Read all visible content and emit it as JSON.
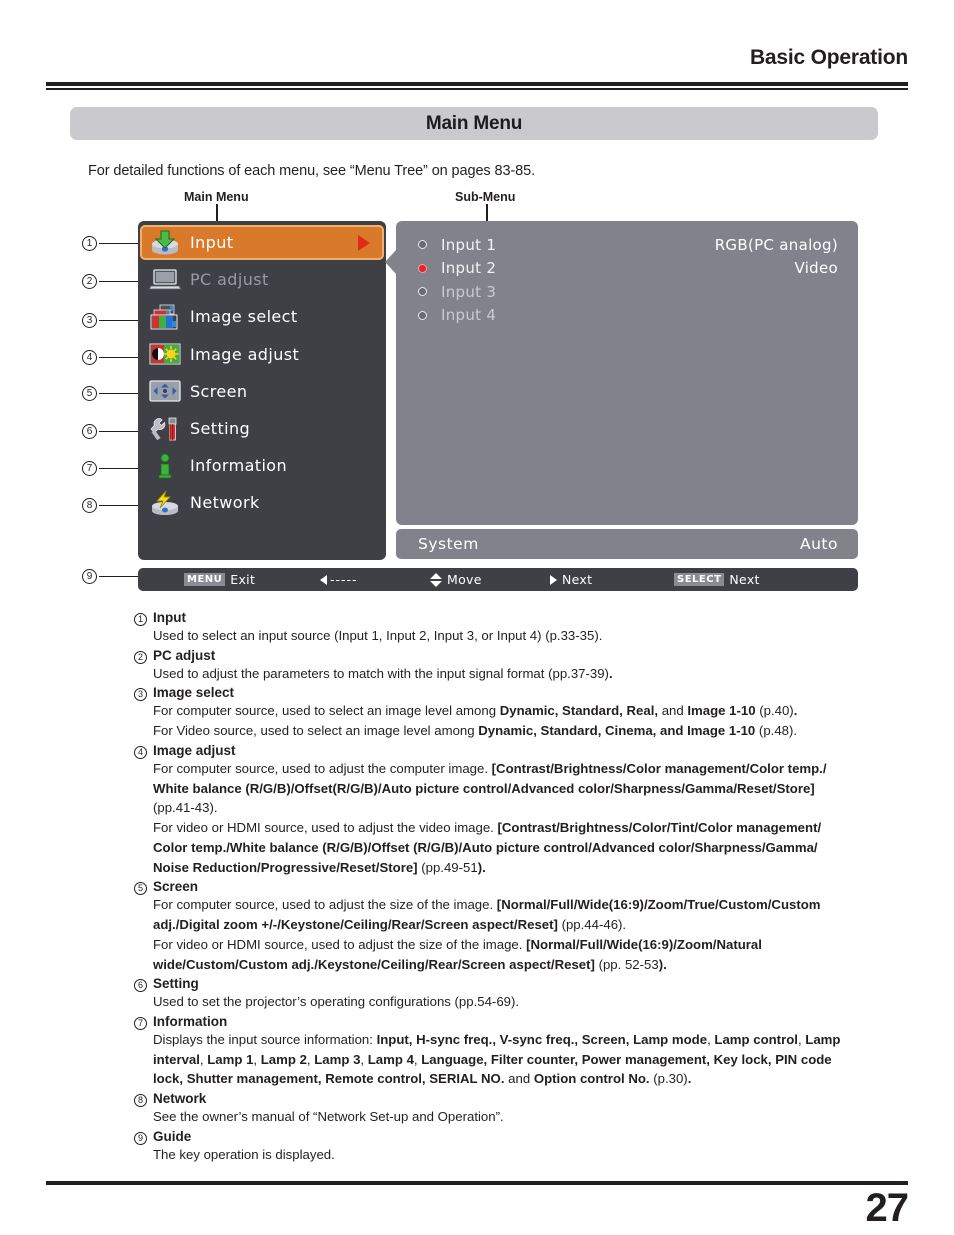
{
  "running_head": "Basic Operation",
  "section_title": "Main Menu",
  "intro": "For detailed functions of each menu, see “Menu Tree” on pages 83-85.",
  "figure": {
    "main_menu_label": "Main Menu",
    "sub_menu_label": "Sub-Menu",
    "main_items": [
      {
        "num": "1",
        "label": "Input",
        "icon": "input-device-download-icon",
        "state": "selected"
      },
      {
        "num": "2",
        "label": "PC adjust",
        "icon": "laptop-icon",
        "state": "disabled"
      },
      {
        "num": "3",
        "label": "Image select",
        "icon": "rgb-cards-icon",
        "state": "normal"
      },
      {
        "num": "4",
        "label": "Image adjust",
        "icon": "contrast-sun-icon",
        "state": "normal"
      },
      {
        "num": "5",
        "label": "Screen",
        "icon": "four-arrows-icon",
        "state": "normal"
      },
      {
        "num": "6",
        "label": "Setting",
        "icon": "wrench-screwdriver-icon",
        "state": "normal"
      },
      {
        "num": "7",
        "label": "Information",
        "icon": "info-i-icon",
        "state": "normal"
      },
      {
        "num": "8",
        "label": "Network",
        "icon": "network-bolt-icon",
        "state": "normal"
      }
    ],
    "sub_items": [
      {
        "label": "Input 1",
        "value": "RGB(PC analog)",
        "selected": false
      },
      {
        "label": "Input 2",
        "value": "Video",
        "selected": true
      },
      {
        "label": "Input 3",
        "value": "",
        "selected": false
      },
      {
        "label": "Input 4",
        "value": "",
        "selected": false
      }
    ],
    "system_row": {
      "label": "System",
      "value": "Auto"
    },
    "guide_bar": {
      "num": "9",
      "exit_key": "MENU",
      "exit_label": "Exit",
      "dashes": "-----",
      "move_label": "Move",
      "next_label": "Next",
      "select_key": "SELECT",
      "select_next_label": "Next"
    },
    "colors": {
      "highlight_orange": "#d97a2b",
      "panel_dark": "#3f3f46",
      "panel_gray": "#82828c",
      "selected_radio_red": "#e8202a",
      "arrow_red": "#e02b18"
    }
  },
  "descriptions": [
    {
      "num": "1",
      "title": "Input",
      "lines": [
        [
          {
            "t": "Used to select an input source (Input 1, Input 2, Input 3, or Input 4) (p.33-35).",
            "b": false
          }
        ]
      ]
    },
    {
      "num": "2",
      "title": "PC adjust",
      "lines": [
        [
          {
            "t": "Used to adjust the parameters to match with the input signal format (pp.37-39)",
            "b": false
          },
          {
            "t": ".",
            "b": true
          }
        ]
      ]
    },
    {
      "num": "3",
      "title": "Image select",
      "lines": [
        [
          {
            "t": "For computer source, used to select an image level among ",
            "b": false
          },
          {
            "t": "Dynamic, Standard, Real,",
            "b": true
          },
          {
            "t": " and ",
            "b": false
          },
          {
            "t": "Image 1-10",
            "b": true
          },
          {
            "t": " (p.40)",
            "b": false
          },
          {
            "t": ".",
            "b": true
          }
        ],
        [
          {
            "t": "For Video source, used to select an image level among ",
            "b": false
          },
          {
            "t": "Dynamic, Standard, Cinema, and Image 1-10",
            "b": true
          },
          {
            "t": " (p.48).",
            "b": false
          }
        ]
      ]
    },
    {
      "num": "4",
      "title": "Image adjust",
      "lines": [
        [
          {
            "t": "For computer source, used to adjust the computer image. ",
            "b": false
          },
          {
            "t": "[Contrast/Brightness/Color management/Color temp./",
            "b": true
          }
        ],
        [
          {
            "t": "White balance (R/G/B)/Offset(R/G/B)/Auto picture control/Advanced color/Sharpness/Gamma/Reset/Store]",
            "b": true
          }
        ],
        [
          {
            "t": "(pp.41-43).",
            "b": false
          }
        ],
        [
          {
            "t": "For video or HDMI source, used to adjust the video image. ",
            "b": false
          },
          {
            "t": "[Contrast/Brightness/Color/Tint/Color management/",
            "b": true
          }
        ],
        [
          {
            "t": "Color temp./White balance (R/G/B)/Offset (R/G/B)/Auto picture control/Advanced color/Sharpness/Gamma/",
            "b": true
          }
        ],
        [
          {
            "t": "Noise Reduction/Progressive/Reset/Store]",
            "b": true
          },
          {
            "t": " (pp.49-51",
            "b": false
          },
          {
            "t": ").",
            "b": true
          }
        ]
      ]
    },
    {
      "num": "5",
      "title": "Screen",
      "lines": [
        [
          {
            "t": "For computer source, used to adjust the size of the image.  ",
            "b": false
          },
          {
            "t": "[Normal/Full/Wide(16:9)/Zoom/True/Custom/Custom",
            "b": true
          }
        ],
        [
          {
            "t": "adj./Digital zoom +/-/Keystone/Ceiling/Rear/Screen aspect/Reset]",
            "b": true
          },
          {
            "t": " (pp.44-46).",
            "b": false
          }
        ],
        [
          {
            "t": "For video or HDMI source, used to adjust the size of the image.  ",
            "b": false
          },
          {
            "t": "[Normal/Full/Wide(16:9)/Zoom/Natural",
            "b": true
          }
        ],
        [
          {
            "t": "wide/Custom/Custom adj./Keystone/Ceiling/Rear/Screen aspect/Reset]",
            "b": true
          },
          {
            "t": " (pp. 52-53",
            "b": false
          },
          {
            "t": ").",
            "b": true
          }
        ]
      ]
    },
    {
      "num": "6",
      "title": "Setting",
      "lines": [
        [
          {
            "t": "Used to set the projector’s operating configurations (pp.54-69).",
            "b": false
          }
        ]
      ]
    },
    {
      "num": "7",
      "title": "Information",
      "lines": [
        [
          {
            "t": "Displays the input source information: ",
            "b": false
          },
          {
            "t": "Input, H-sync freq., V-sync freq., Screen, Lamp mode",
            "b": true
          },
          {
            "t": ", ",
            "b": false
          },
          {
            "t": "Lamp control",
            "b": true
          },
          {
            "t": ", ",
            "b": false
          },
          {
            "t": "Lamp",
            "b": true
          }
        ],
        [
          {
            "t": "interval",
            "b": true
          },
          {
            "t": ", ",
            "b": false
          },
          {
            "t": "Lamp 1",
            "b": true
          },
          {
            "t": ", ",
            "b": false
          },
          {
            "t": "Lamp 2",
            "b": true
          },
          {
            "t": ", ",
            "b": false
          },
          {
            "t": "Lamp 3",
            "b": true
          },
          {
            "t": ", ",
            "b": false
          },
          {
            "t": "Lamp 4",
            "b": true
          },
          {
            "t": ", ",
            "b": false
          },
          {
            "t": "Language, Filter counter, Power management, Key lock, PIN code",
            "b": true
          }
        ],
        [
          {
            "t": "lock, Shutter management, Remote control, SERIAL NO.",
            "b": true
          },
          {
            "t": " and ",
            "b": false
          },
          {
            "t": "Option control No.",
            "b": true
          },
          {
            "t": " (p.30)",
            "b": false
          },
          {
            "t": ".",
            "b": true
          }
        ]
      ]
    },
    {
      "num": "8",
      "title": "Network",
      "lines": [
        [
          {
            "t": "See the owner’s manual of “Network Set-up and Operation”.",
            "b": false
          }
        ]
      ]
    },
    {
      "num": "9",
      "title": "Guide",
      "lines": [
        [
          {
            "t": "The key operation is displayed.",
            "b": false
          }
        ]
      ]
    }
  ],
  "page_number": "27"
}
